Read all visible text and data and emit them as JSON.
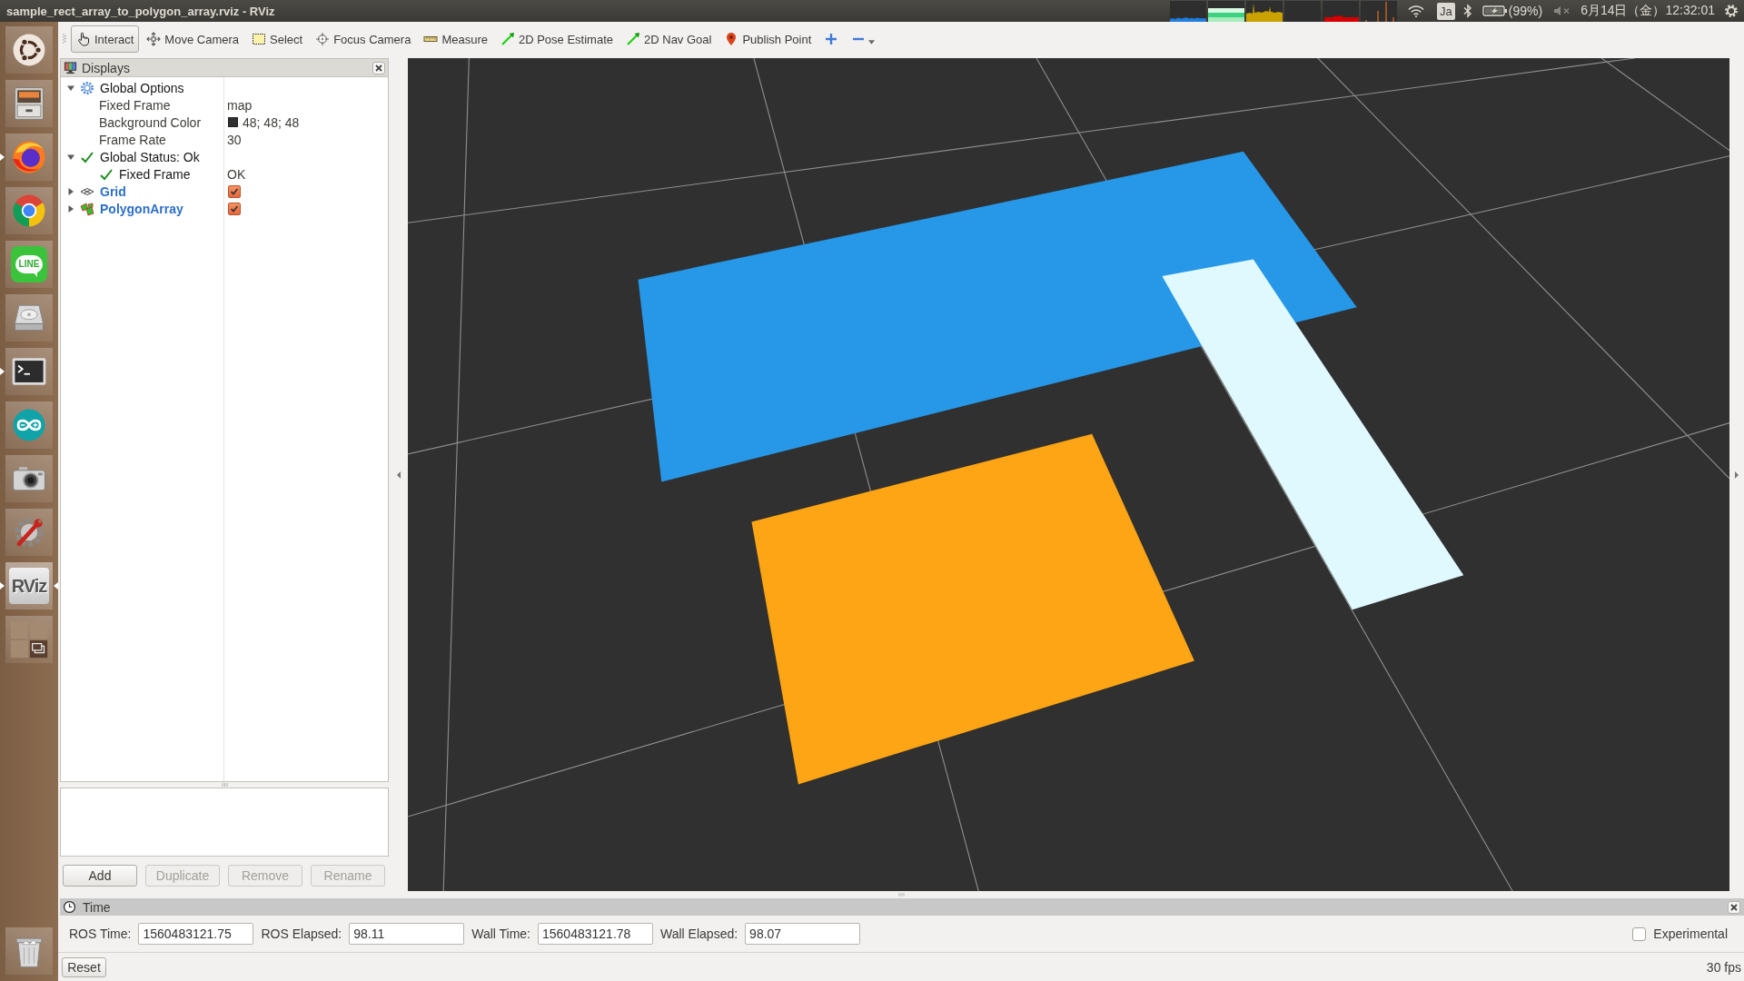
{
  "window": {
    "title": "sample_rect_array_to_polygon_array.rviz - RViz"
  },
  "top_panel": {
    "input_method": "Ja",
    "battery": "(99%)",
    "clock": "6月14日（金）12:32:01"
  },
  "launcher": [
    {
      "kind": "ubuntu",
      "running": false,
      "focused": false
    },
    {
      "kind": "files",
      "running": false,
      "focused": false
    },
    {
      "kind": "firefox",
      "running": true,
      "focused": false
    },
    {
      "kind": "chrome",
      "running": false,
      "focused": false
    },
    {
      "kind": "line",
      "label": "LINE",
      "running": false,
      "focused": false
    },
    {
      "kind": "drive",
      "running": false,
      "focused": false
    },
    {
      "kind": "terminal",
      "running": true,
      "focused": false
    },
    {
      "kind": "arduino",
      "running": false,
      "focused": false
    },
    {
      "kind": "camera",
      "running": false,
      "focused": false
    },
    {
      "kind": "settings",
      "running": false,
      "focused": false
    },
    {
      "kind": "rviz",
      "label": "RViz",
      "running": true,
      "focused": true
    },
    {
      "kind": "workspaces",
      "running": false,
      "focused": false
    },
    {
      "kind": "trash",
      "running": false,
      "focused": false
    }
  ],
  "toolbar": [
    {
      "kind": "interact",
      "label": "Interact",
      "selected": true
    },
    {
      "kind": "move_camera",
      "label": "Move Camera",
      "selected": false
    },
    {
      "kind": "select",
      "label": "Select",
      "selected": false
    },
    {
      "kind": "focus_camera",
      "label": "Focus Camera",
      "selected": false
    },
    {
      "kind": "measure",
      "label": "Measure",
      "selected": false
    },
    {
      "kind": "pose",
      "label": "2D Pose Estimate",
      "selected": false
    },
    {
      "kind": "nav_goal",
      "label": "2D Nav Goal",
      "selected": false
    },
    {
      "kind": "publish_point",
      "label": "Publish Point",
      "selected": false
    }
  ],
  "displays": {
    "title": "Displays",
    "tree": [
      {
        "kind": "options",
        "label": "Global Options",
        "expanded": true,
        "children": [
          {
            "kind": "property",
            "label": "Fixed Frame",
            "value": "map"
          },
          {
            "kind": "color",
            "label": "Background Color",
            "value": "48; 48; 48",
            "color": "#303030"
          },
          {
            "kind": "property",
            "label": "Frame Rate",
            "value": "30"
          }
        ]
      },
      {
        "kind": "status",
        "label": "Global Status: Ok",
        "expanded": true,
        "children": [
          {
            "kind": "status",
            "label": "Fixed Frame",
            "value": "OK"
          }
        ]
      },
      {
        "kind": "grid",
        "label": "Grid",
        "expanded": false,
        "checked": true
      },
      {
        "kind": "polygon_array",
        "label": "PolygonArray",
        "expanded": false,
        "checked": true
      }
    ],
    "buttons": [
      {
        "label": "Add",
        "disabled": false
      },
      {
        "label": "Duplicate",
        "disabled": true
      },
      {
        "label": "Remove",
        "disabled": true
      },
      {
        "label": "Rename",
        "disabled": true
      }
    ]
  },
  "time_panel": {
    "title": "Time",
    "fields": [
      {
        "label": "ROS Time:",
        "value": "1560483121.75"
      },
      {
        "label": "ROS Elapsed:",
        "value": "98.11"
      },
      {
        "label": "Wall Time:",
        "value": "1560483121.78"
      },
      {
        "label": "Wall Elapsed:",
        "value": "98.07"
      }
    ],
    "experimental": {
      "label": "Experimental",
      "checked": false
    },
    "reset": "Reset",
    "fps": "30 fps"
  }
}
